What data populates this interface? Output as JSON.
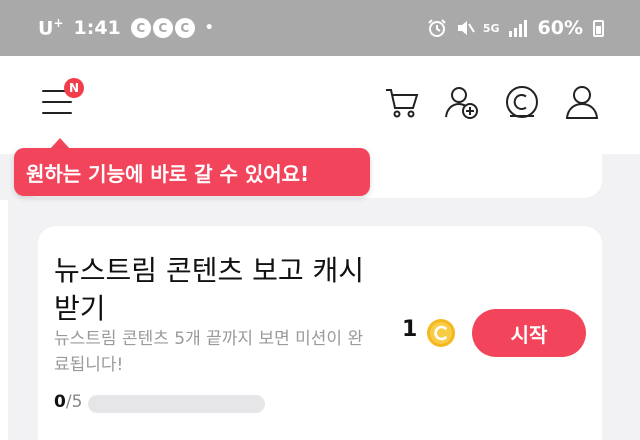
{
  "status_bar": {
    "carrier": "U",
    "carrier_sup": "+",
    "time": "1:41",
    "cc_badges": [
      "C",
      "C",
      "C"
    ],
    "dot": "•",
    "network": "5G",
    "battery": "60%"
  },
  "header": {
    "menu_badge": "N"
  },
  "tooltip": {
    "text": "원하는 기능에 바로 갈 수 있어요!"
  },
  "mission": {
    "title": "뉴스트림 콘텐츠 보고 캐시 받기",
    "description": "뉴스트림 콘텐츠 5개 끝까지 보면 미션이 완료됩니다!",
    "reward": "1",
    "start_label": "시작",
    "progress_current": "0",
    "progress_total": "/5",
    "progress_fraction": 0
  },
  "colors": {
    "accent": "#f2455c",
    "status_bar": "#a9a9a9",
    "coin": "#f5b71f"
  }
}
